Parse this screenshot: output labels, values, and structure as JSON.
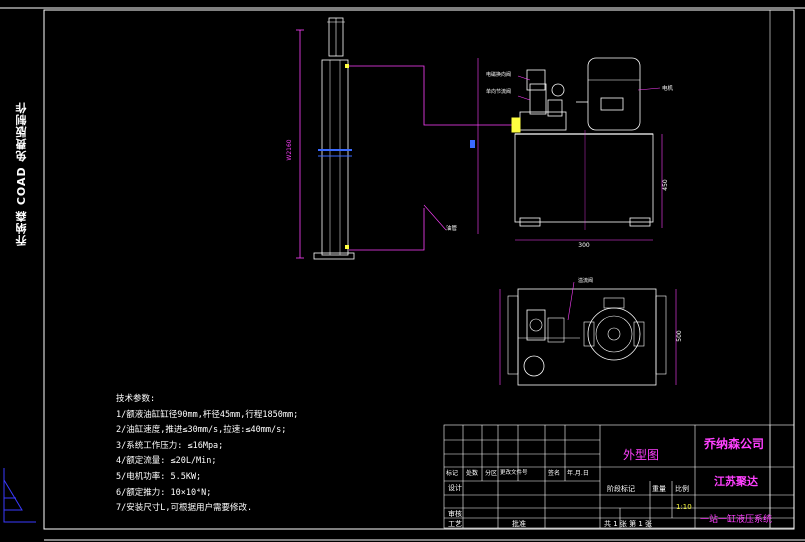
{
  "side_text": "乔纳森 COAD 免费版制作",
  "specs": {
    "title": "技术参数:",
    "lines": [
      "1/额液油缸缸径90mm,杆径45mm,行程1850mm;",
      "2/油缸速度,推进≤30mm/s,拉速:≤40mm/s;",
      "3/系统工作压力: ≤16Mpa;",
      "4/额定流量: ≤20L/Min;",
      "5/电机功率: 5.5KW;",
      "6/额定推力: 10×10⁴N;",
      "7/安装尺寸L,可根据用户需要修改."
    ]
  },
  "dimensions": {
    "cylinder_length": "W2160",
    "tank_width": "300",
    "tank_height": "450",
    "plan_width": "500"
  },
  "callouts": {
    "top1": "电磁换向阀",
    "top2": "单向节流阀",
    "motor": "电机",
    "pipe": "油管",
    "plan": "溢流阀"
  },
  "title_block": {
    "drawing_name": "外型图",
    "company": "乔纳森公司",
    "city": "江苏聚达",
    "product": "一站一缸液压系统",
    "headers": [
      "标记",
      "处数",
      "分区",
      "更改文件号",
      "签名",
      "年.月.日"
    ],
    "design": "设计",
    "review": "审核",
    "process": "工艺",
    "approve": "批准",
    "stage": "阶段标记",
    "weight": "重量",
    "scale": "比例",
    "scale_value": "1:10",
    "sheets": "共 1 张  第 1 张"
  }
}
